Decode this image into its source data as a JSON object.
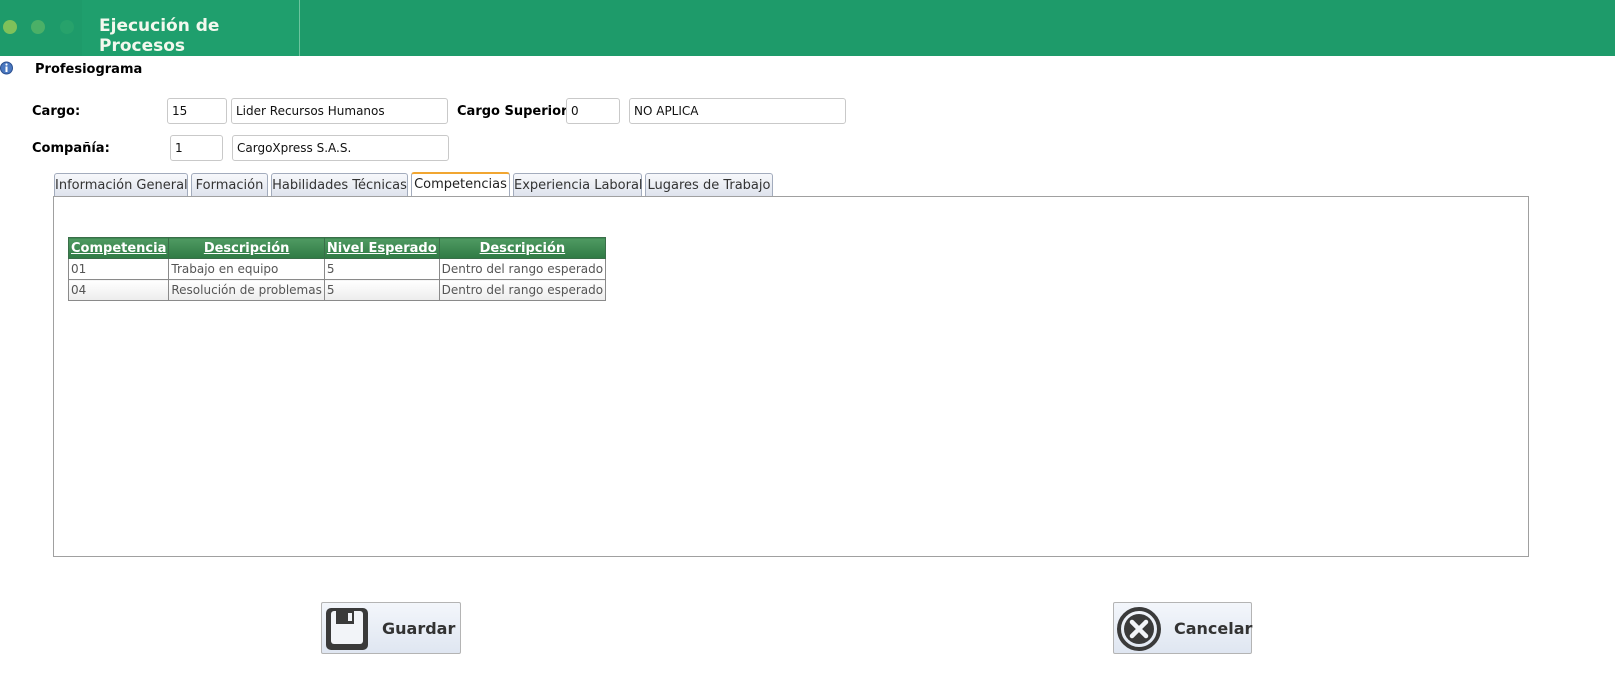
{
  "header": {
    "title": "Ejecución de Procesos",
    "color": "#1e9b6a"
  },
  "subtitle": "Profesiograma",
  "form": {
    "cargo_label": "Cargo:",
    "cargo_code": "15",
    "cargo_name": "Lider Recursos Humanos",
    "superior_label": "Cargo Superior:",
    "superior_code": "0",
    "superior_name": "NO APLICA",
    "compania_label": "Compañía:",
    "compania_code": "1",
    "compania_name": "CargoXpress S.A.S."
  },
  "tabs": [
    {
      "label": "Información General"
    },
    {
      "label": "Formación"
    },
    {
      "label": "Habilidades Técnicas"
    },
    {
      "label": "Competencias",
      "active": true
    },
    {
      "label": "Experiencia Laboral"
    },
    {
      "label": "Lugares de Trabajo"
    }
  ],
  "grid": {
    "headers": [
      "Competencia",
      "Descripción",
      "Nivel Esperado",
      "Descripción"
    ],
    "rows": [
      [
        "01",
        "Trabajo en equipo",
        "5",
        "Dentro del rango esperado"
      ],
      [
        "04",
        "Resolución de problemas",
        "5",
        "Dentro del rango esperado"
      ]
    ]
  },
  "buttons": {
    "save_label": "Guardar",
    "save_icon": "floppy-disk-icon",
    "cancel_label": "Cancelar",
    "cancel_icon": "close-circle-icon"
  }
}
